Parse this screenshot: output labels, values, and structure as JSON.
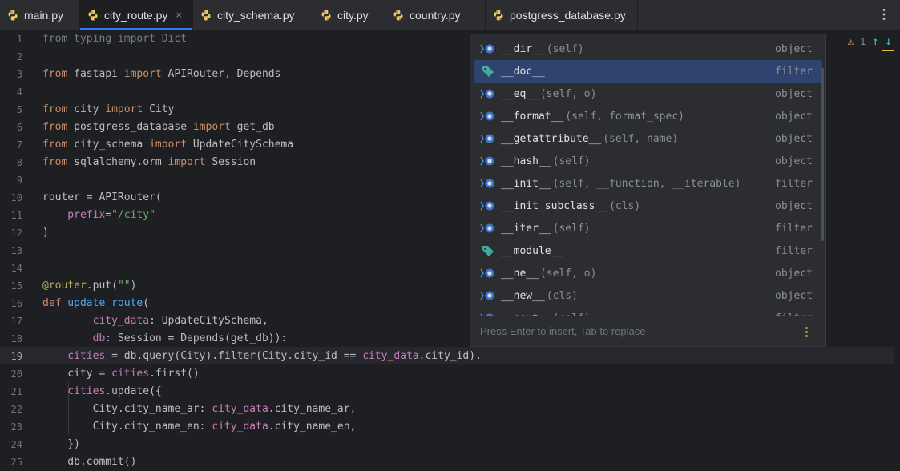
{
  "tabs": [
    {
      "label": "main.py",
      "active": false,
      "closable": false
    },
    {
      "label": "city_route.py",
      "active": true,
      "closable": true
    },
    {
      "label": "city_schema.py",
      "active": false,
      "closable": false
    },
    {
      "label": "city.py",
      "active": false,
      "closable": false
    },
    {
      "label": "country.py",
      "active": false,
      "closable": false
    },
    {
      "label": "postgress_database.py",
      "active": false,
      "closable": false
    }
  ],
  "tab_close_glyph": "×",
  "inspection": {
    "warning_count": "1"
  },
  "line_numbers": [
    "1",
    "2",
    "3",
    "4",
    "5",
    "6",
    "7",
    "8",
    "9",
    "10",
    "11",
    "12",
    "13",
    "14",
    "15",
    "16",
    "17",
    "18",
    "19",
    "20",
    "21",
    "22",
    "23",
    "24",
    "25"
  ],
  "current_line": "19",
  "code": {
    "l1": [
      "from typing import Dict"
    ],
    "l3_from": "from",
    "l3_mod": " fastapi ",
    "l3_imp": "import",
    "l3_rest": " APIRouter",
    "l3_comma": ",",
    "l3_rest2": " Depends",
    "l5_from": "from",
    "l5_mod": " city ",
    "l5_imp": "import",
    "l5_rest": " City",
    "l6_from": "from",
    "l6_mod": " postgress_database ",
    "l6_imp": "import",
    "l6_rest": " get_db",
    "l7_from": "from",
    "l7_mod": " city_schema ",
    "l7_imp": "import",
    "l7_rest": " UpdateCitySchema",
    "l8_from": "from",
    "l8_mod": " sqlalchemy.orm ",
    "l8_imp": "import",
    "l8_rest": " Session",
    "l10_a": "router = APIRouter(",
    "l11_param": "    prefix",
    "l11_eq": "=",
    "l11_str": "\"/city\"",
    "l12": ")",
    "l15_deco": "@router",
    "l15_rest": ".put(",
    "l15_str": "\"\"",
    "l15_close": ")",
    "l16_def": "def",
    "l16_fn": " update_route",
    "l16_paren": "(",
    "l17_param": "        city_data",
    "l17_rest": ": UpdateCitySchema,",
    "l18_param": "        db",
    "l18_rest": ": Session = Depends(get_db)):",
    "l19_a": "    cities",
    "l19_b": " = db.query(City).filter(City.city_id == ",
    "l19_c": "city_data",
    "l19_d": ".city_id).",
    "l20_a": "    city = ",
    "l20_b": "cities",
    "l20_c": ".first()",
    "l21_a": "    cities",
    "l21_b": ".update({",
    "l22_a": "        City.city_name_ar: ",
    "l22_b": "city_data",
    "l22_c": ".city_name_ar,",
    "l23_a": "        City.city_name_en: ",
    "l23_b": "city_data",
    "l23_c": ".city_name_en,",
    "l24": "    })",
    "l25": "    db.commit()"
  },
  "completion": {
    "items": [
      {
        "name": "__dir__",
        "args": "(self)",
        "type": "object",
        "icon": "method-icon"
      },
      {
        "name": "__doc__",
        "args": "",
        "type": "filter",
        "icon": "field-tag-icon",
        "selected": true
      },
      {
        "name": "__eq__",
        "args": "(self, o)",
        "type": "object",
        "icon": "method-icon"
      },
      {
        "name": "__format__",
        "args": "(self, format_spec)",
        "type": "object",
        "icon": "method-icon"
      },
      {
        "name": "__getattribute__",
        "args": "(self, name)",
        "type": "object",
        "icon": "method-icon"
      },
      {
        "name": "__hash__",
        "args": "(self)",
        "type": "object",
        "icon": "method-icon"
      },
      {
        "name": "__init__",
        "args": "(self, __function, __iterable)",
        "type": "filter",
        "icon": "method-icon"
      },
      {
        "name": "__init_subclass__",
        "args": "(cls)",
        "type": "object",
        "icon": "method-icon"
      },
      {
        "name": "__iter__",
        "args": "(self)",
        "type": "filter",
        "icon": "method-icon"
      },
      {
        "name": "__module__",
        "args": "",
        "type": "filter",
        "icon": "field-tag-icon"
      },
      {
        "name": "__ne__",
        "args": "(self, o)",
        "type": "object",
        "icon": "method-icon"
      },
      {
        "name": "__new__",
        "args": "(cls)",
        "type": "object",
        "icon": "method-icon"
      },
      {
        "name": "__next__",
        "args": "(self)",
        "type": "filter",
        "icon": "method-icon"
      }
    ],
    "footer_hint": "Press Enter to insert, Tab to replace"
  },
  "colors": {
    "accent": "#3574f0",
    "selection": "#2e436e",
    "warning": "#e4b83a"
  }
}
